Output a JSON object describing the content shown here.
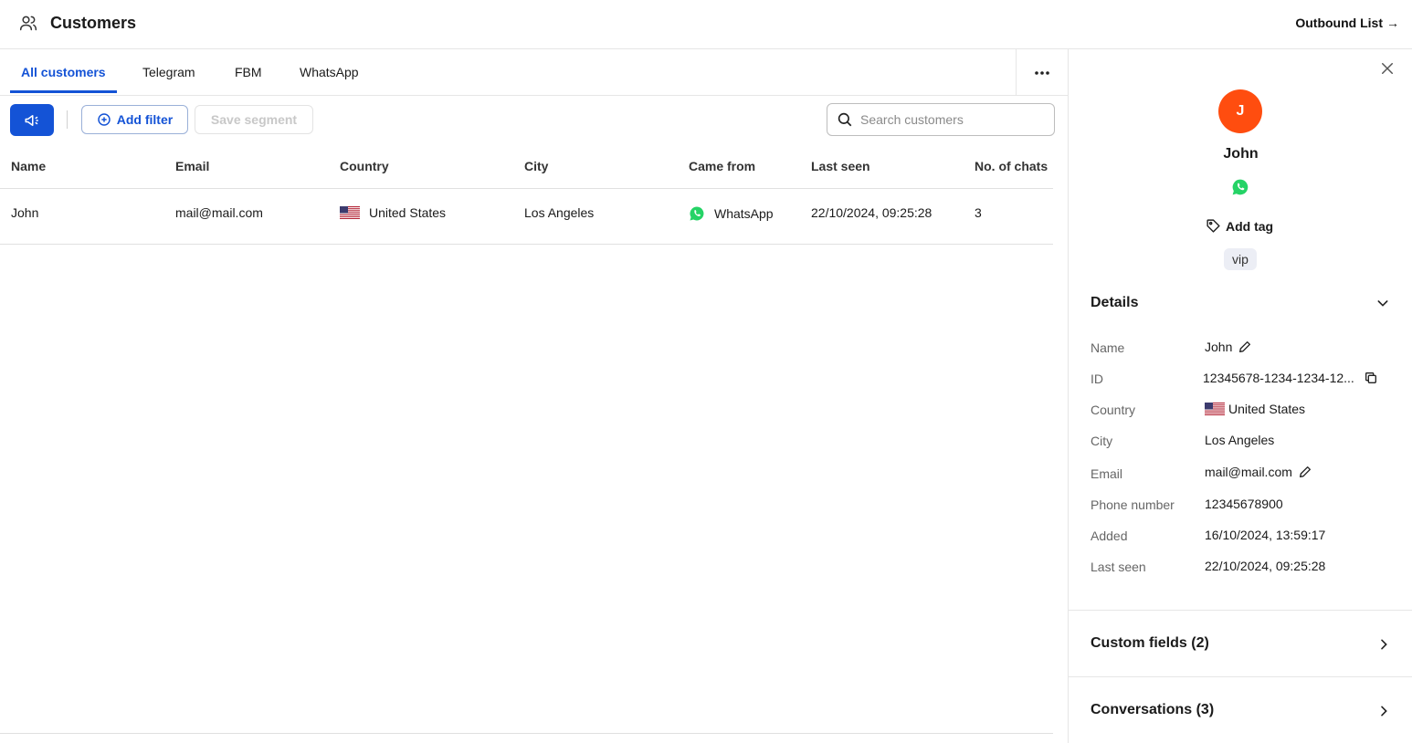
{
  "header": {
    "title": "Customers",
    "outbound_link": "Outbound List",
    "arrow": "→"
  },
  "tabs": [
    {
      "label": "All customers",
      "active": true
    },
    {
      "label": "Telegram",
      "active": false
    },
    {
      "label": "FBM",
      "active": false
    },
    {
      "label": "WhatsApp",
      "active": false
    }
  ],
  "toolbar": {
    "add_filter_label": "Add filter",
    "save_segment_label": "Save segment",
    "search_placeholder": "Search customers"
  },
  "table": {
    "columns": [
      "Name",
      "Email",
      "Country",
      "City",
      "Came from",
      "Last seen",
      "No. of chats"
    ],
    "rows": [
      {
        "name": "John",
        "email": "mail@mail.com",
        "country": "United States",
        "city": "Los Angeles",
        "came_from": "WhatsApp",
        "last_seen": "22/10/2024, 09:25:28",
        "chats": "3"
      }
    ]
  },
  "panel": {
    "avatar_initial": "J",
    "customer_name": "John",
    "add_tag_label": "Add tag",
    "tags": [
      "vip"
    ],
    "details_title": "Details",
    "details": [
      {
        "label": "Name",
        "value": "John"
      },
      {
        "label": "ID",
        "value": "12345678-1234-1234-12..."
      },
      {
        "label": "Country",
        "value": "United States"
      },
      {
        "label": "City",
        "value": "Los Angeles"
      },
      {
        "label": "Email",
        "value": "mail@mail.com"
      },
      {
        "label": "Phone number",
        "value": "12345678900"
      },
      {
        "label": "Added",
        "value": "16/10/2024, 13:59:17"
      },
      {
        "label": "Last seen",
        "value": "22/10/2024, 09:25:28"
      }
    ],
    "custom_fields_title": "Custom fields (2)",
    "conversations_title": "Conversations (3)"
  },
  "colors": {
    "accent": "#1453d6",
    "avatar": "#ff4d0f",
    "whatsapp": "#25d366"
  },
  "icons": [
    "users-icon",
    "arrow-right-icon",
    "more-horizontal-icon",
    "megaphone-icon",
    "plus-circle-icon",
    "search-icon",
    "us-flag-icon",
    "whatsapp-icon",
    "close-icon",
    "tag-icon",
    "chevron-down-icon",
    "pencil-icon",
    "copy-icon",
    "chevron-right-icon"
  ]
}
